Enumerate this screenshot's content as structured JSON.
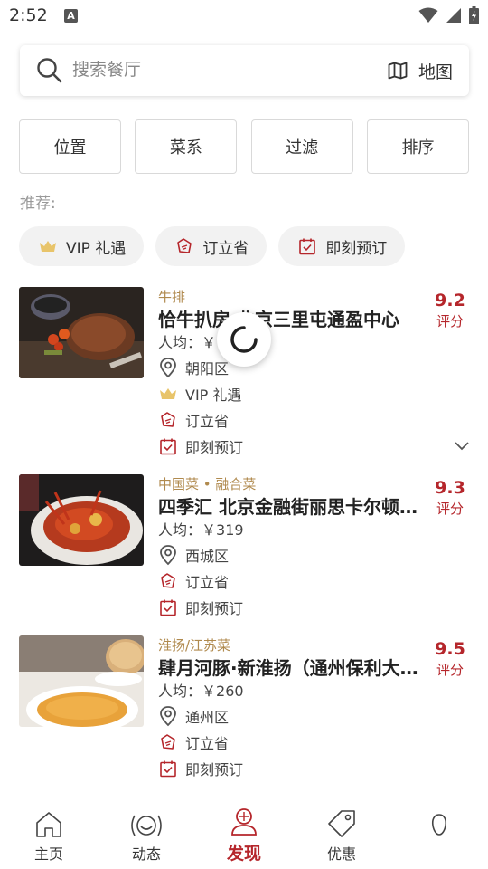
{
  "status_bar": {
    "time": "2:52",
    "notification_badge": "A"
  },
  "search": {
    "placeholder": "搜索餐厅",
    "map_label": "地图"
  },
  "filters": [
    "位置",
    "菜系",
    "过滤",
    "排序"
  ],
  "recommend": {
    "label": "推荐:",
    "chips": [
      {
        "icon": "crown-icon",
        "label": "VIP 礼遇"
      },
      {
        "icon": "tag-icon",
        "label": "订立省"
      },
      {
        "icon": "calendar-check-icon",
        "label": "即刻预订"
      }
    ]
  },
  "restaurants": [
    {
      "cuisine": "牛排",
      "name": "恰牛扒房 北京三里屯通盈中心",
      "price_label": "人均：",
      "price_currency": "￥",
      "price": "",
      "district": "朝阳区",
      "perks": [
        "VIP 礼遇",
        "订立省",
        "即刻预订"
      ],
      "rating": "9.2",
      "rating_label": "评分"
    },
    {
      "cuisine": "中国菜 • 融合菜",
      "name": "四季汇 北京金融街丽思卡尔顿酒店",
      "price_label": "人均：",
      "price_currency": "￥",
      "price": "319",
      "district": "西城区",
      "perks": [
        "订立省",
        "即刻预订"
      ],
      "rating": "9.3",
      "rating_label": "评分"
    },
    {
      "cuisine": "淮扬/江苏菜",
      "name": "肆月河豚·新淮扬（通州保利大都会）",
      "price_label": "人均：",
      "price_currency": "￥",
      "price": "260",
      "district": "通州区",
      "perks": [
        "订立省",
        "即刻预订"
      ],
      "rating": "9.5",
      "rating_label": "评分"
    }
  ],
  "nav": [
    {
      "label": "主页",
      "icon": "home-icon"
    },
    {
      "label": "动态",
      "icon": "feed-icon"
    },
    {
      "label": "发现",
      "icon": "discover-icon",
      "active": true
    },
    {
      "label": "优惠",
      "icon": "coupon-icon"
    },
    {
      "label": "",
      "icon": "profile-icon"
    }
  ],
  "colors": {
    "accent": "#b5262b",
    "cuisine": "#b08a4e",
    "crown": "#e8c46a"
  }
}
